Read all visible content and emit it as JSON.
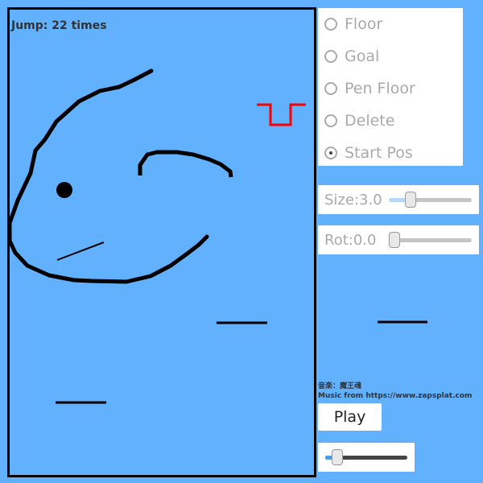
{
  "status": {
    "jump_text": "Jump: 22 times"
  },
  "tools": {
    "options": [
      "Floor",
      "Goal",
      "Pen Floor",
      "Delete",
      "Start Pos"
    ],
    "selected": "Start Pos"
  },
  "size_slider": {
    "label": "Size:3.0",
    "value": 3.0
  },
  "rot_slider": {
    "label": "Rot:0.0",
    "value": 0.0
  },
  "credits": {
    "music_line1": "音楽：魔王魂",
    "music_line2": "Music from https://www.zapsplat.com"
  },
  "play_button": {
    "label": "Play"
  },
  "volume_slider": {
    "value": 0.12
  },
  "colors": {
    "background": "#62b1ff",
    "goal": "#ff0000",
    "stroke": "#000000",
    "panel": "#ffffff",
    "disabled_text": "#aaaaaa"
  }
}
